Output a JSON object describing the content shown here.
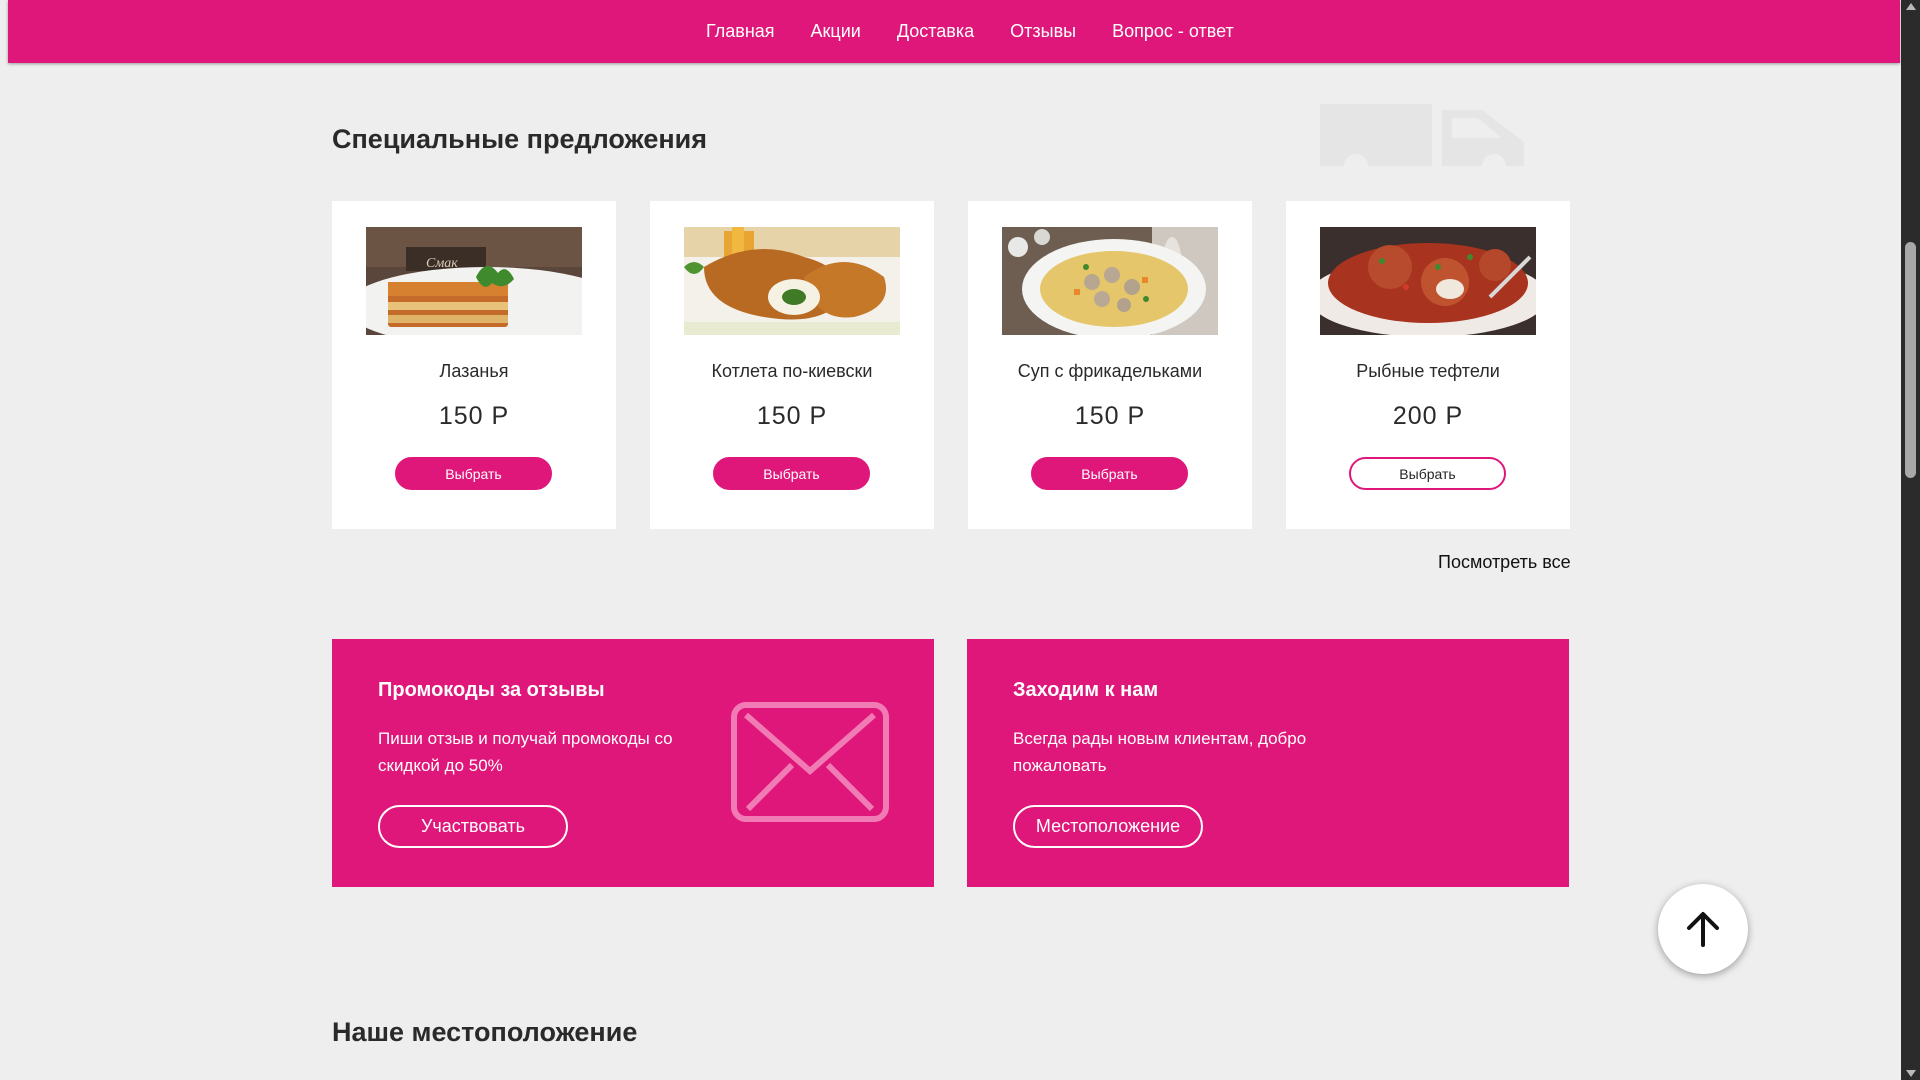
{
  "nav": {
    "items": [
      "Главная",
      "Акции",
      "Доставка",
      "Отзывы",
      "Вопрос - ответ"
    ]
  },
  "special": {
    "title": "Специальные предложения",
    "view_all": "Посмотреть все",
    "cards": [
      {
        "name": "Лазанья",
        "price": "150 Р",
        "button": "Выбрать",
        "image": "lasagna"
      },
      {
        "name": "Котлета по-киевски",
        "price": "150 Р",
        "button": "Выбрать",
        "image": "chicken-kiev"
      },
      {
        "name": "Суп с фрикадельками",
        "price": "150 Р",
        "button": "Выбрать",
        "image": "meatball-soup"
      },
      {
        "name": "Рыбные тефтели",
        "price": "200 Р",
        "button": "Выбрать",
        "image": "fish-meatballs"
      }
    ]
  },
  "promo": {
    "reviews": {
      "title": "Промокоды за отзывы",
      "text": "Пиши отзыв и получай промокоды со скидкой до 50%",
      "button": "Участвовать"
    },
    "visit": {
      "title": "Заходим к нам",
      "text": "Всегда рады новым клиентам, добро пожаловать",
      "button": "Местоположение"
    }
  },
  "location": {
    "title": "Наше местоположение"
  },
  "colors": {
    "accent": "#e0177a",
    "background": "#efeeee"
  },
  "icons": [
    "truck-icon",
    "envelope-icon",
    "arrow-up-icon"
  ]
}
